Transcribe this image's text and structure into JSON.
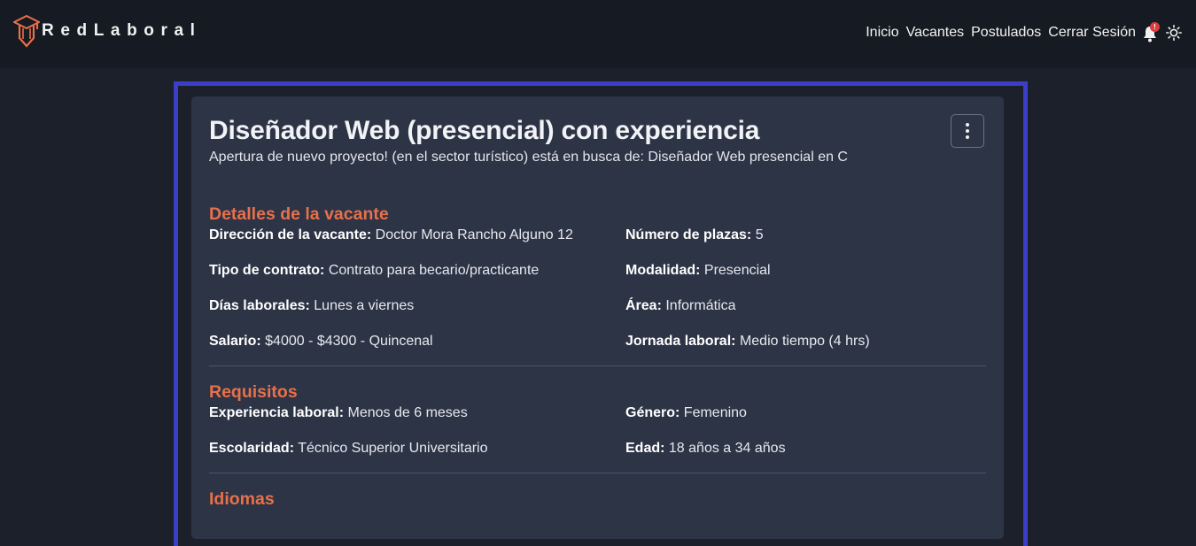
{
  "brand": {
    "name": "RedLaboral",
    "logo_icon": "graduation-cap-pencil-icon",
    "accent_color": "#e8704a"
  },
  "nav": {
    "links": [
      "Inicio",
      "Vacantes",
      "Postulados",
      "Cerrar Sesión"
    ],
    "notification_badge": "!",
    "icons": [
      "bell-icon",
      "sun-icon"
    ]
  },
  "vacancy": {
    "title": "Diseñador Web (presencial) con experiencia",
    "subtitle": "Apertura de nuevo proyecto! (en el sector turístico) está en busca de: Diseñador Web presencial en C",
    "menu_icon": "kebab-menu-icon",
    "details": {
      "heading": "Detalles de la vacante",
      "fields": [
        {
          "label": "Dirección de la vacante:",
          "value": "Doctor Mora Rancho Alguno 12"
        },
        {
          "label": "Número de plazas:",
          "value": "5"
        },
        {
          "label": "Tipo de contrato:",
          "value": "Contrato para becario/practicante"
        },
        {
          "label": "Modalidad:",
          "value": "Presencial"
        },
        {
          "label": "Días laborales:",
          "value": "Lunes a viernes"
        },
        {
          "label": "Área:",
          "value": "Informática"
        },
        {
          "label": "Salario:",
          "value": "$4000 - $4300 - Quincenal"
        },
        {
          "label": "Jornada laboral:",
          "value": "Medio tiempo (4 hrs)"
        }
      ]
    },
    "requirements": {
      "heading": "Requisitos",
      "fields": [
        {
          "label": "Experiencia laboral:",
          "value": "Menos de 6 meses"
        },
        {
          "label": "Género:",
          "value": "Femenino"
        },
        {
          "label": "Escolaridad:",
          "value": "Técnico Superior Universitario"
        },
        {
          "label": "Edad:",
          "value": "18 años a 34 años"
        }
      ]
    },
    "languages": {
      "heading": "Idiomas"
    }
  },
  "colors": {
    "frame_border": "#3b3fc8",
    "card_bg": "#2d3446",
    "page_bg": "#1b202b",
    "navbar_bg": "#161a22"
  }
}
